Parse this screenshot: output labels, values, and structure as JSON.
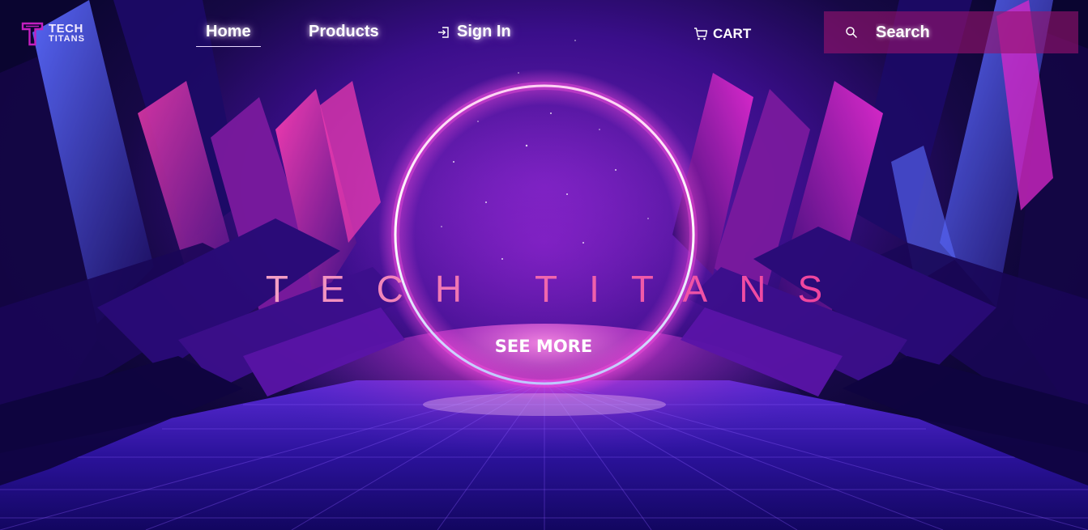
{
  "brand": {
    "logo_line1": "TECH",
    "logo_line2": "TITANS"
  },
  "nav": {
    "home_label": "Home",
    "products_label": "Products",
    "signin_label": "Sign In",
    "cart_label": "CART",
    "active_item": "Home"
  },
  "search": {
    "placeholder": "Search"
  },
  "hero": {
    "title": "TECH TITANS",
    "cta_label": "SEE MORE"
  },
  "icons": {
    "logo": "logo-t-icon",
    "signin": "sign-in-icon",
    "cart": "cart-icon",
    "search": "search-icon"
  },
  "colors": {
    "accent_pink": "#f04aa2",
    "logo_magenta": "#c41fbf",
    "search_bg": "#96146e",
    "ring_glow": "#ff3fd0"
  }
}
